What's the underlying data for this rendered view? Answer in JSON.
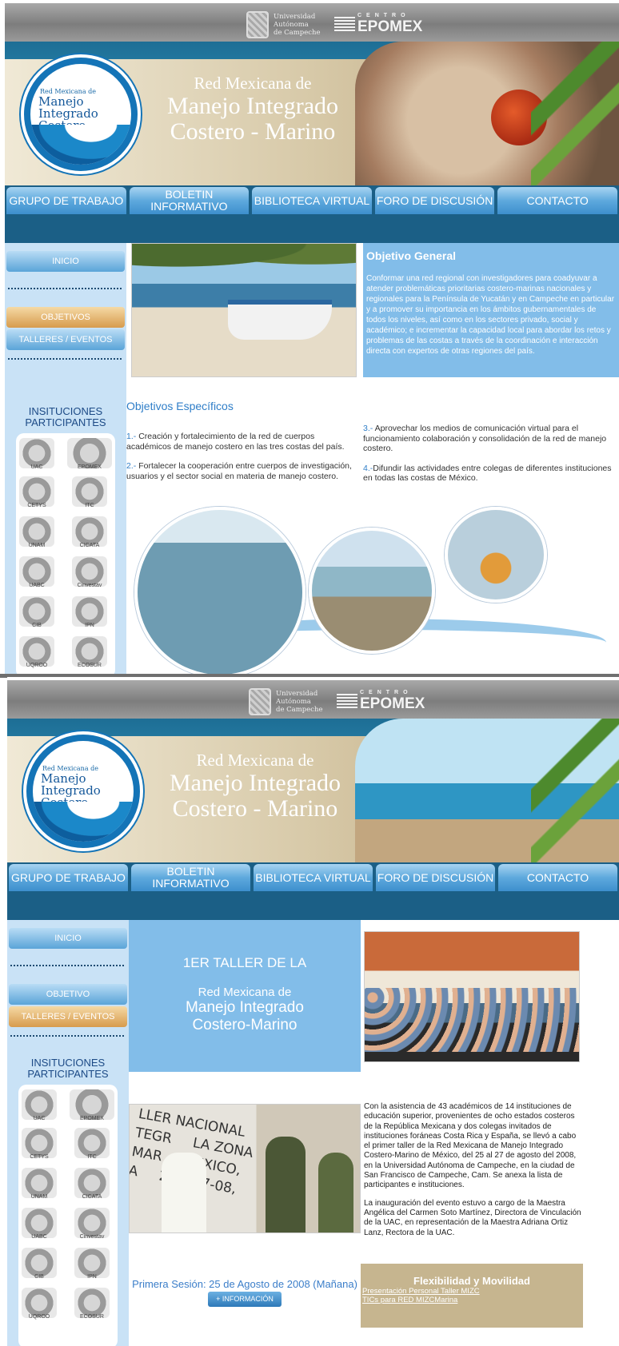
{
  "header": {
    "uac_text": "Universidad\nAutónoma\nde Campeche",
    "epomex_small": "CENTRO",
    "epomex_big": "EPOMEX"
  },
  "banner": {
    "logo_small": "Red Mexicana de",
    "logo_big": "Manejo Integrado Costero-Marino",
    "title_small": "Red Mexicana de",
    "title_line1": "Manejo Integrado",
    "title_line2": "Costero - Marino"
  },
  "nav": {
    "items": [
      {
        "label": "GRUPO de TRABAJO"
      },
      {
        "label": "BOLETIN INFORMATIVO"
      },
      {
        "label": "BIBLIOTECA VIRTUAL"
      },
      {
        "label": "FORO de DISCUSIÓN"
      },
      {
        "label": "CONTACTO"
      }
    ]
  },
  "sidebar": {
    "inicio": "INICIO",
    "objetivos": "OBJETIVOS",
    "objetivo": "OBJETIVO",
    "talleres": "TALLERES / EVENTOS",
    "inst_title": "INSITUCIONES PARTICIPANTES",
    "logos": [
      "UAC",
      "EPOMEX",
      "CETYS",
      "ITC",
      "UNAM",
      "CICATA",
      "UABC",
      "Cinvestav",
      "CIB",
      "IPN",
      "UQROO",
      "ECOSUR"
    ]
  },
  "page1": {
    "objetivo_general_title": "Objetivo General",
    "objetivo_general_text": "Conformar una red regional con investigadores para coadyuvar a atender problemáticas prioritarias costero-marinas nacionales y regionales para la Península de Yucatán y en Campeche en particular y a promover su importancia en los ámbitos gubernamentales de todos los niveles, así como en los sectores privado, social y académico; e incrementar la capacidad local para abordar los retos y problemas de las costas a través de la coordinación e interacción directa con expertos de otras regiones del país.",
    "objetivos_especificos": "Objetivos Específicos",
    "obj1_num": "1.-",
    "obj1": "Creación y fortalecimiento de la red de cuerpos académicos de manejo costero en las tres costas del país.",
    "obj2_num": "2.-",
    "obj2": "Fortalecer la cooperación entre cuerpos de investigación, usuarios y el sector social en materia de manejo costero.",
    "obj3_num": "3.-",
    "obj3": "Aprovechar los medios de comunicación virtual para el funcionamiento colaboración y consolidación de la red de manejo costero.",
    "obj4_num": "4.-",
    "obj4": "Difundir las actividades entre colegas de diferentes instituciones en todas las costas de México."
  },
  "page2": {
    "title_a": "1ER TALLER DE LA",
    "title_b": "Red Mexicana de",
    "title_c1": "Manejo Integrado",
    "title_c2": "Costero-Marino",
    "photo_text": "LLER NACIONAL\nTEGR     LA ZONA\nMAR     MEXICO,\nA     26 Y 27-08,",
    "para1": "Con la asistencia de 43 académicos de 14 instituciones de educación superior, provenientes de ocho estados costeros de la República Mexicana y dos colegas invitados de instituciones foráneas Costa Rica y España, se llevó a cabo el primer taller de la Red Mexicana de Manejo Integrado Costero-Marino de México, del 25 al 27 de agosto del 2008, en la Universidad Autónoma de Campeche, en la ciudad de San Francisco de Campeche, Cam. Se anexa la lista de participantes e instituciones.",
    "para2": "La inauguración del evento estuvo a cargo de la Maestra Angélica del Carmen Soto Martínez, Directora de Vinculación de la UAC, en representación de la Maestra Adriana Ortiz Lanz, Rectora de la UAC.",
    "session": "Primera Sesión: 25 de Agosto de 2008 (Mañana)",
    "info_button": "+ INFORMACIÓN",
    "flex_title": "Flexibilidad y Movilidad",
    "link1": "Presentación Personal Taller MIZC",
    "link2": "TICs para RED MIZCMarina"
  }
}
